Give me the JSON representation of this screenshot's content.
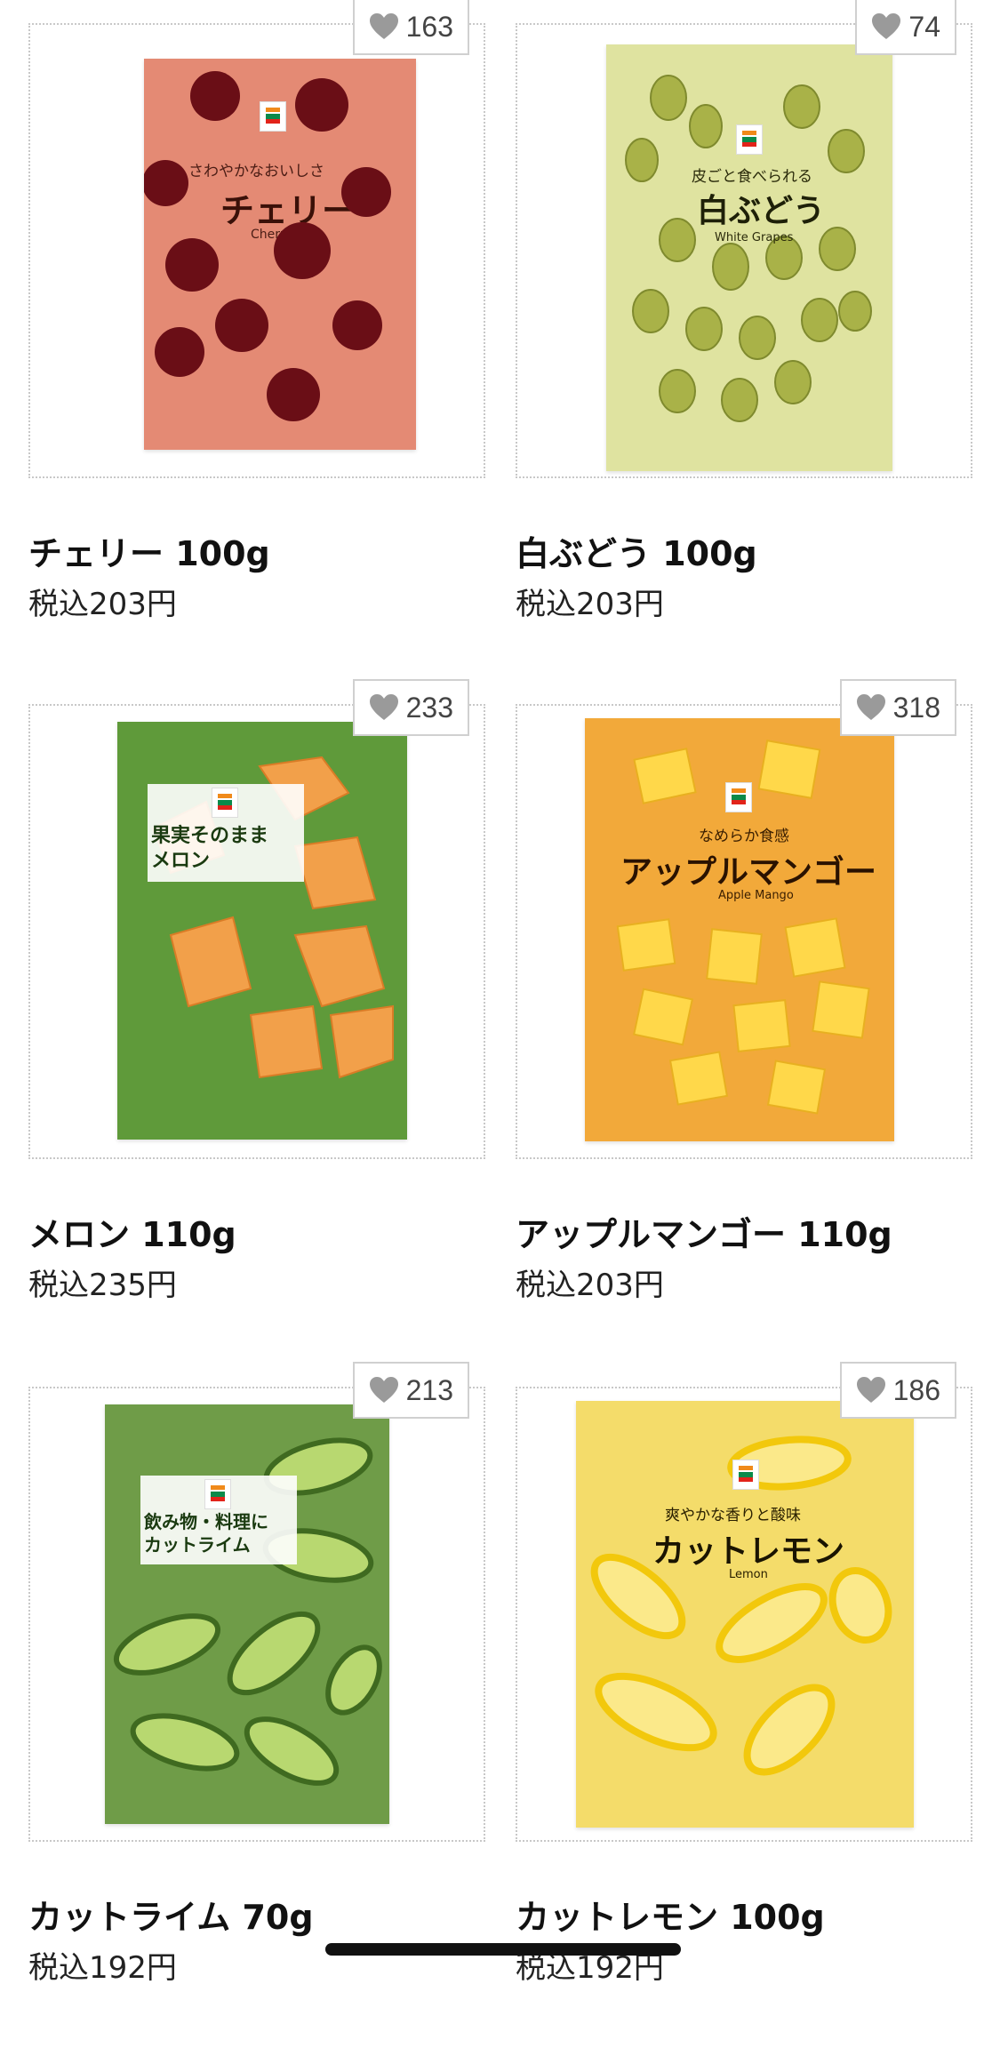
{
  "products": [
    {
      "name": "チェリー 100g",
      "price": "税込203円",
      "likes": "163",
      "pack": {
        "tagline": "さわやかなおいしさ",
        "title": "チェリー",
        "en": "Cherry"
      }
    },
    {
      "name": "白ぶどう 100g",
      "price": "税込203円",
      "likes": "74",
      "pack": {
        "tagline": "皮ごと食べられる",
        "title": "白ぶどう",
        "en": "White Grapes"
      }
    },
    {
      "name": "メロン 110g",
      "price": "税込235円",
      "likes": "233",
      "pack": {
        "tagline": "果実そのまま",
        "title": "メロン",
        "en": ""
      }
    },
    {
      "name": "アップルマンゴー 110g",
      "price": "税込203円",
      "likes": "318",
      "pack": {
        "tagline": "なめらか食感",
        "title": "アップルマンゴー",
        "en": "Apple Mango"
      }
    },
    {
      "name": "カットライム 70g",
      "price": "税込192円",
      "likes": "213",
      "pack": {
        "tagline": "飲み物・料理に",
        "title": "カットライム",
        "en": ""
      }
    },
    {
      "name": "カットレモン 100g",
      "price": "税込192円",
      "likes": "186",
      "pack": {
        "tagline": "爽やかな香りと酸味",
        "title": "カットレモン",
        "en": "Lemon"
      }
    }
  ],
  "colors": {
    "cherry_bg": "#e48a74",
    "grape_bg": "#dfe3a0",
    "melon_bg": "#5f9a3a",
    "mango_bg": "#f2a93a",
    "lime_bg": "#6f9c48",
    "lemon_bg": "#f4dc6a",
    "heart": "#9a9a9a"
  },
  "icons": {
    "like": "heart-icon",
    "brand": "seven-eleven-logo"
  }
}
